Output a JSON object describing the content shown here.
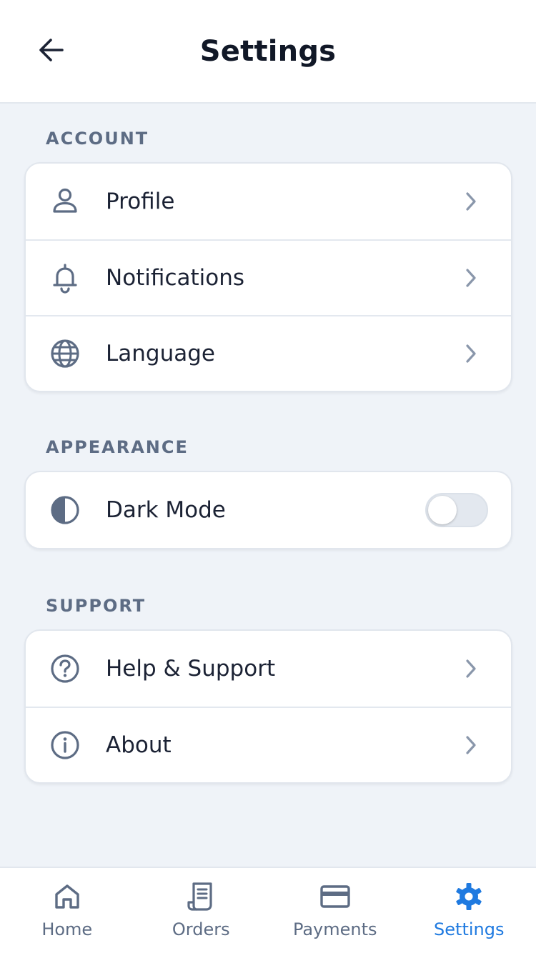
{
  "header": {
    "title": "Settings",
    "back_icon": "arrow-left-icon"
  },
  "sections": [
    {
      "label": "ACCOUNT",
      "items": [
        {
          "label": "Profile",
          "icon": "user-icon"
        },
        {
          "label": "Notifications",
          "icon": "bell-icon"
        },
        {
          "label": "Language",
          "icon": "globe-icon"
        }
      ]
    },
    {
      "label": "APPEARANCE",
      "items": [
        {
          "label": "Dark Mode",
          "icon": "contrast-icon",
          "toggle": false
        }
      ]
    },
    {
      "label": "SUPPORT",
      "items": [
        {
          "label": "Help & Support",
          "icon": "help-circle-icon"
        },
        {
          "label": "About",
          "icon": "info-circle-icon"
        }
      ]
    }
  ],
  "bottom_nav": {
    "items": [
      {
        "label": "Home",
        "icon": "home-icon",
        "active": false
      },
      {
        "label": "Orders",
        "icon": "receipt-icon",
        "active": false
      },
      {
        "label": "Payments",
        "icon": "credit-card-icon",
        "active": false
      },
      {
        "label": "Settings",
        "icon": "gear-icon",
        "active": true
      }
    ]
  },
  "colors": {
    "background": "#eff3f8",
    "icon": "#5d6c84",
    "chevron": "#8a97ab",
    "accent": "#1f7ae0",
    "text": "#1b2234"
  }
}
